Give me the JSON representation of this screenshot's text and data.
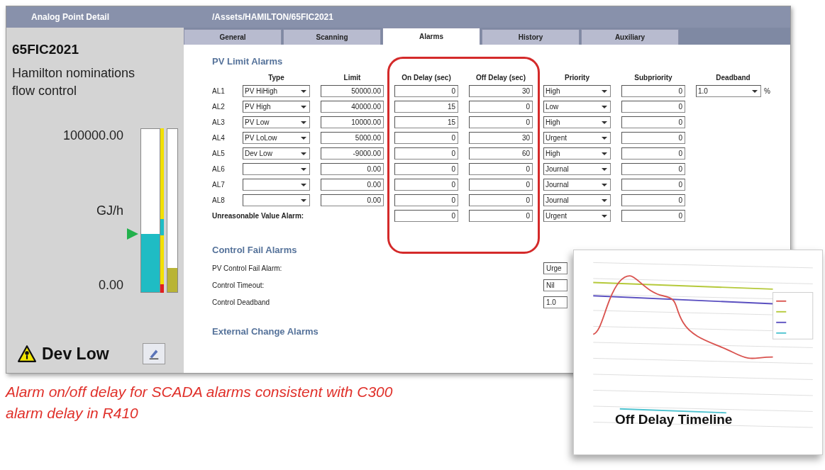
{
  "window": {
    "title": "Analog Point Detail",
    "path": "/Assets/HAMILTON/65FIC2021"
  },
  "point": {
    "name": "65FIC2021",
    "description": "Hamilton nominations flow control",
    "scale_max": "100000.00",
    "unit": "GJ/h",
    "scale_min": "0.00",
    "pv_bar": {
      "level": 0.36
    },
    "output_bar": {
      "level": 0.15
    },
    "alarm": "Dev Low"
  },
  "tabs": [
    {
      "label": "General",
      "selected": false
    },
    {
      "label": "Scanning",
      "selected": false
    },
    {
      "label": "Alarms",
      "selected": true
    },
    {
      "label": "History",
      "selected": false
    },
    {
      "label": "Auxiliary",
      "selected": false
    }
  ],
  "pv_limit_alarms": {
    "title": "PV Limit Alarms",
    "columns": [
      "Type",
      "Limit",
      "On Delay (sec)",
      "Off Delay (sec)",
      "Priority",
      "Subpriority",
      "Deadband"
    ],
    "rows": [
      {
        "label": "AL1",
        "type": "PV HiHigh",
        "limit": "50000.00",
        "on_delay": "0",
        "off_delay": "30",
        "priority": "High",
        "subpriority": "0"
      },
      {
        "label": "AL2",
        "type": "PV High",
        "limit": "40000.00",
        "on_delay": "15",
        "off_delay": "0",
        "priority": "Low",
        "subpriority": "0"
      },
      {
        "label": "AL3",
        "type": "PV Low",
        "limit": "10000.00",
        "on_delay": "15",
        "off_delay": "0",
        "priority": "High",
        "subpriority": "0"
      },
      {
        "label": "AL4",
        "type": "PV LoLow",
        "limit": "5000.00",
        "on_delay": "0",
        "off_delay": "30",
        "priority": "Urgent",
        "subpriority": "0"
      },
      {
        "label": "AL5",
        "type": "Dev Low",
        "limit": "-9000.00",
        "on_delay": "0",
        "off_delay": "60",
        "priority": "High",
        "subpriority": "0"
      },
      {
        "label": "AL6",
        "limit": "0.00",
        "on_delay": "0",
        "off_delay": "0",
        "priority": "Journal",
        "subpriority": "0"
      },
      {
        "label": "AL7",
        "limit": "0.00",
        "on_delay": "0",
        "off_delay": "0",
        "priority": "Journal",
        "subpriority": "0"
      },
      {
        "label": "AL8",
        "limit": "0.00",
        "on_delay": "0",
        "off_delay": "0",
        "priority": "Journal",
        "subpriority": "0"
      }
    ],
    "unreasonable": {
      "label": "Unreasonable Value Alarm:",
      "on_delay": "0",
      "off_delay": "0",
      "priority": "Urgent",
      "subpriority": "0"
    },
    "deadband": {
      "value": "1.0",
      "unit": "%"
    }
  },
  "control_fail_alarms": {
    "title": "Control Fail Alarms",
    "rows": [
      {
        "label": "PV Control Fail Alarm:",
        "value": "Urge"
      },
      {
        "label": "Control Timeout:",
        "value": "Nil"
      },
      {
        "label": "Control Deadband",
        "value": "1.0"
      }
    ]
  },
  "external_change_alarms": {
    "title": "External Change Alarms"
  },
  "inset_chart": {
    "title": "Off Delay Timeline"
  },
  "caption": "Alarm on/off delay for SCADA alarms consistent with C300 alarm delay in R410"
}
